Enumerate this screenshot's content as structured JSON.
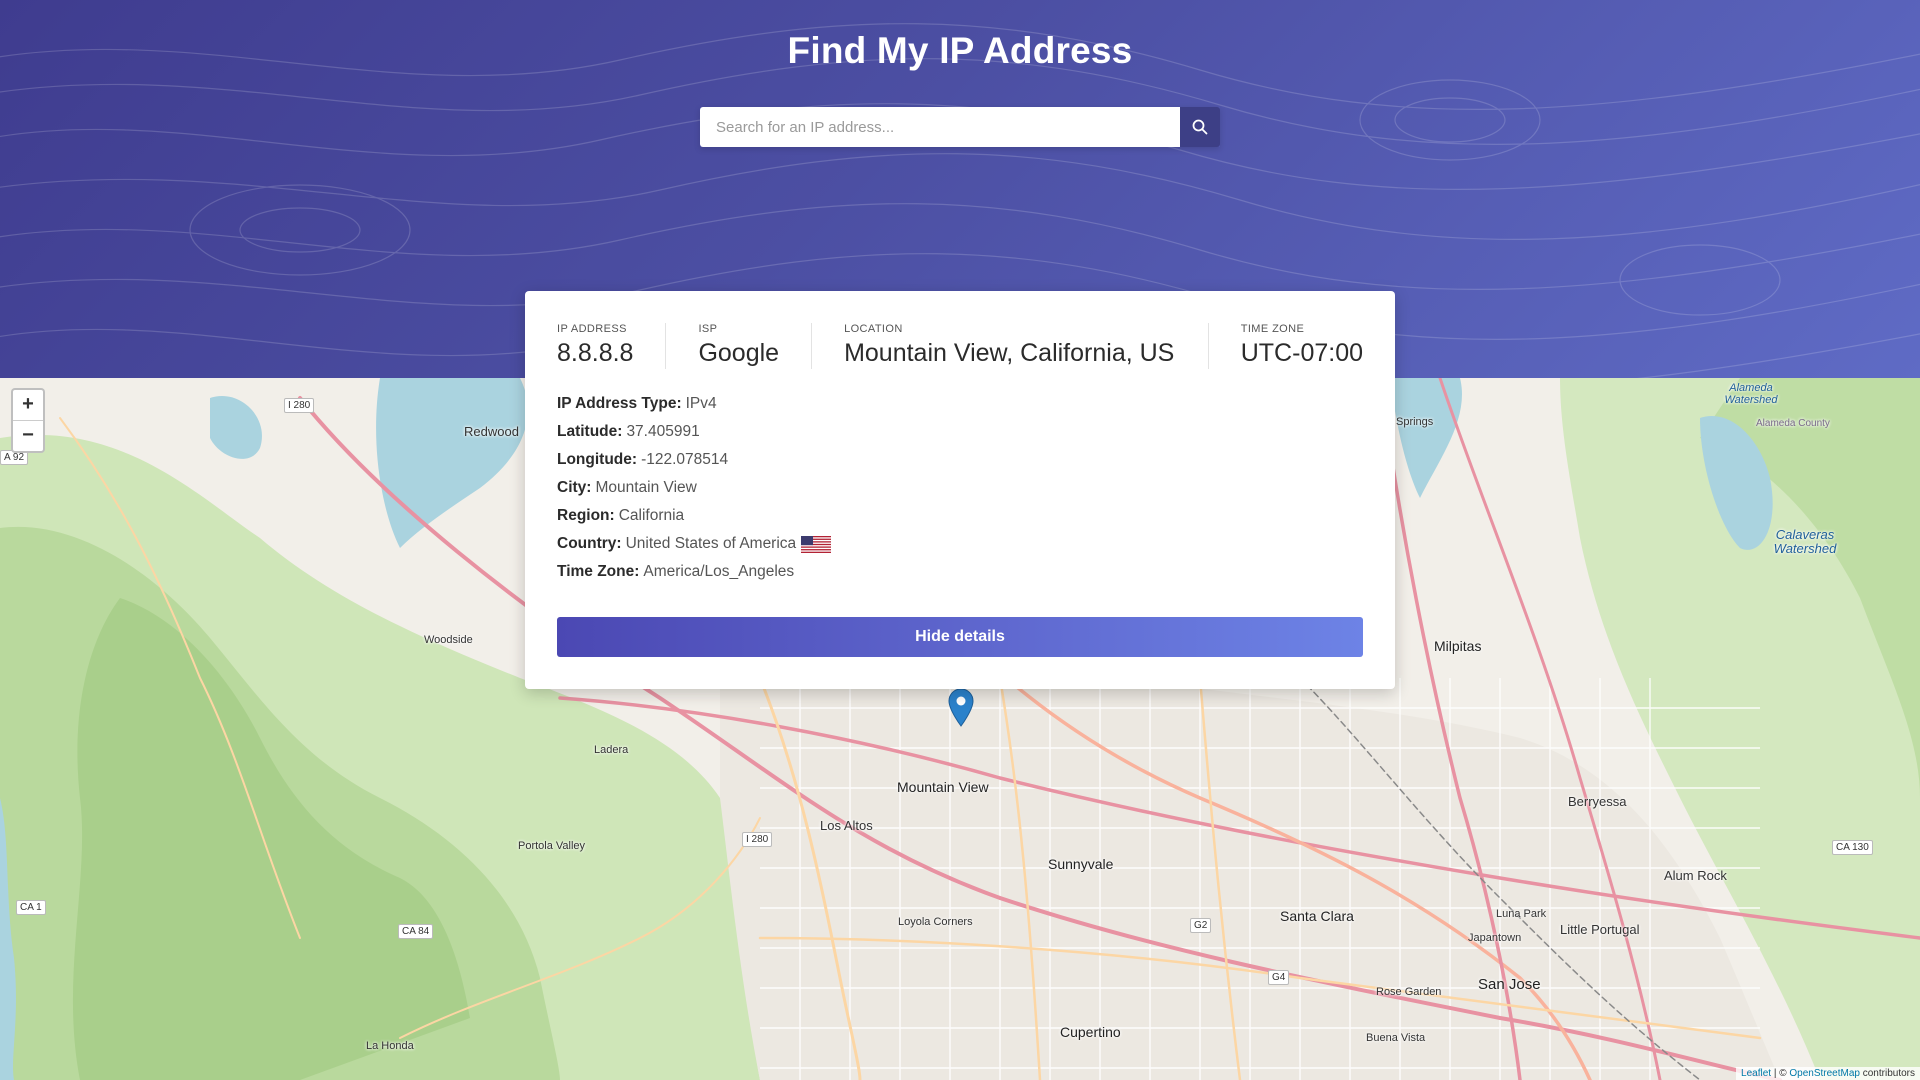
{
  "app": {
    "title": "Find My IP Address"
  },
  "search": {
    "placeholder": "Search for an IP address...",
    "button_icon": "search-icon"
  },
  "summary": {
    "ip_label": "IP ADDRESS",
    "ip_value": "8.8.8.8",
    "isp_label": "ISP",
    "isp_value": "Google",
    "location_label": "LOCATION",
    "location_value": "Mountain View, California, US",
    "timezone_label": "TIME ZONE",
    "timezone_value": "UTC-07:00"
  },
  "details": {
    "type_label": "IP Address Type:",
    "type_value": "IPv4",
    "lat_label": "Latitude:",
    "lat_value": "37.405991",
    "lon_label": "Longitude:",
    "lon_value": "-122.078514",
    "city_label": "City:",
    "city_value": "Mountain View",
    "region_label": "Region:",
    "region_value": "California",
    "country_label": "Country:",
    "country_value": "United States of America",
    "tz_label": "Time Zone:",
    "tz_value": "America/Los_Angeles",
    "flag_icon": "us-flag-icon"
  },
  "hide_button": "Hide details",
  "map": {
    "zoom_in": "+",
    "zoom_out": "−",
    "attribution_leaflet": "Leaflet",
    "attribution_sep": " | © ",
    "attribution_osm": "OpenStreetMap",
    "attribution_tail": " contributors",
    "places": {
      "mountain_view": "Mountain View",
      "sunnyvale": "Sunnyvale",
      "santa_clara": "Santa Clara",
      "san_jose": "San Jose",
      "cupertino": "Cupertino",
      "los_altos": "Los Altos",
      "milpitas": "Milpitas",
      "berryessa": "Berryessa",
      "alum_rock": "Alum Rock",
      "little_portugal": "Little Portugal",
      "japantown": "Japantown",
      "luna_park": "Luna Park",
      "rose_garden": "Rose Garden",
      "buena_vista": "Buena Vista",
      "loyola_corners": "Loyola Corners",
      "portola_valley": "Portola Valley",
      "woodside": "Woodside",
      "la_honda": "La Honda",
      "ladera": "Ladera",
      "redwood": "Redwood",
      "springs": "Springs",
      "calaveras_watershed": "Calaveras Watershed",
      "alameda_watershed": "Alameda Watershed",
      "alameda_county": "Alameda County"
    },
    "roads": {
      "i280_a": "I 280",
      "i280_b": "I 280",
      "ca84": "CA 84",
      "ca1": "CA 1",
      "ca130": "CA 130",
      "ca92": "A 92",
      "g2": "G2",
      "g4": "G4"
    }
  },
  "colors": {
    "header_start": "#3f3c8f",
    "header_end": "#5f6bc5",
    "button_start": "#4b48b3",
    "button_end": "#6d83e6",
    "marker": "#2b82cb"
  }
}
